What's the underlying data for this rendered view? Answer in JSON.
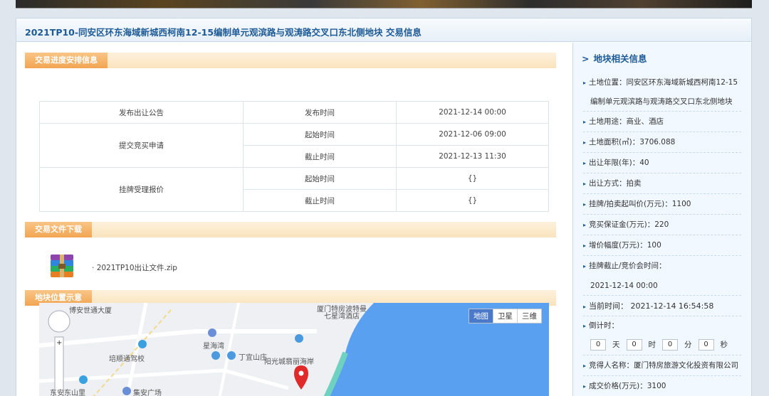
{
  "page": {
    "title": "2021TP10-同安区环东海域新城西柯南12-15编制单元观滨路与观涛路交叉口东北侧地块  交易信息"
  },
  "schedule": {
    "header": "交易进度安排信息",
    "rows": [
      {
        "group": "发布出让公告",
        "label": "发布时间",
        "value": "2021-12-14 00:00"
      },
      {
        "group": "提交竞买申请",
        "label": "起始时间",
        "value": "2021-12-06 09:00"
      },
      {
        "group": "",
        "label": "截止时间",
        "value": "2021-12-13 11:30"
      },
      {
        "group": "挂牌受理报价",
        "label": "起始时间",
        "value": "{}"
      },
      {
        "group": "",
        "label": "截止时间",
        "value": "{}"
      }
    ]
  },
  "files": {
    "header": "交易文件下载",
    "items": [
      {
        "name": "2021TP10出让文件.zip",
        "prefix": "·"
      }
    ]
  },
  "map": {
    "header": "地块位置示意",
    "buttons": [
      "地图",
      "卫星",
      "三维"
    ],
    "active_button": "地图",
    "labels": [
      "博安世通大厦",
      "厦门特房波特曼",
      "七星湾酒店",
      "星海湾",
      "丁宜山庄",
      "培顺通驾校",
      "阳光城翡丽海岸",
      "东安东山里",
      "集安广场"
    ]
  },
  "sidebar": {
    "title": "地块相关信息",
    "location_label": "土地位置：同安区环东海域新城西柯南12-15",
    "location_cont": "编制单元观滨路与观涛路交叉口东北侧地块",
    "use": "土地用途：商业、酒店",
    "area": "土地面积(㎡)：3706.088",
    "years": "出让年限(年)：40",
    "method": "出让方式：拍卖",
    "start_price": "挂牌/拍卖起叫价(万元)：1100",
    "deposit": "竞买保证金(万元)：220",
    "increment": "增价幅度(万元)：100",
    "deadline_label": "挂牌截止/竞价会时间：",
    "deadline_value": "2021-12-14 00:00",
    "current_time": "当前时间：  2021-12-14 16:54:58",
    "countdown_label": "倒计时：",
    "countdown": {
      "d": "0",
      "h": "0",
      "m": "0",
      "s": "0"
    },
    "countdown_units": {
      "d": "天",
      "h": "时",
      "m": "分",
      "s": "秒"
    },
    "winner": "竞得人名称：厦门特房旅游文化投资有限公司",
    "deal_price": "成交价格(万元)：3100"
  },
  "colors": {
    "title_blue": "#1d5a96",
    "tab_orange": "#f2a552",
    "sidebar_bg": "#f1f8ff"
  }
}
